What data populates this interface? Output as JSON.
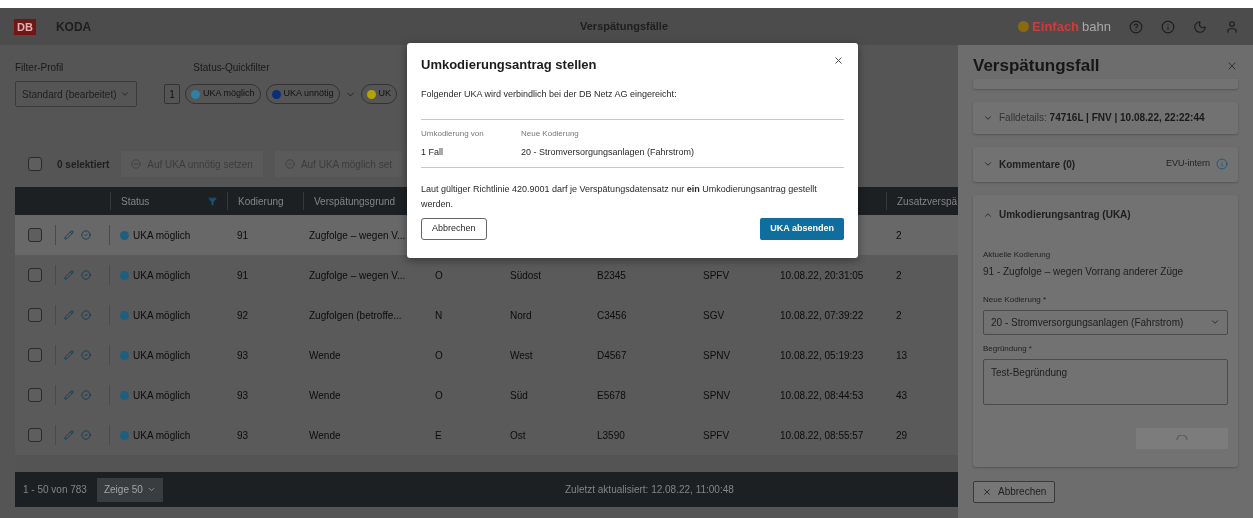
{
  "header": {
    "logo": "DB",
    "app_name": "KODA",
    "title": "Verspätungsfälle",
    "brand_bold": "Einfach",
    "brand_light": "bahn"
  },
  "filter": {
    "profile_label": "Filter-Profil",
    "profile_value": "Standard (bearbeitet)",
    "count": "1",
    "quickfilter_label": "Status-Quickfilter",
    "chips": [
      {
        "label": "UKA möglich",
        "color": "#2f7fa6"
      },
      {
        "label": "UKA unnötig",
        "color": "#0b2e7a"
      },
      {
        "label": "UK",
        "color": "#b3a400"
      }
    ]
  },
  "actions": {
    "select_all_checked": false,
    "selected_count": "0 selektiert",
    "buttons": [
      {
        "label": "Auf UKA unnötig setzen",
        "kind": "minus"
      },
      {
        "label": "Auf UKA möglich set",
        "kind": "check"
      }
    ]
  },
  "table": {
    "columns": [
      "Status",
      "Kodierung",
      "Verspätungsgrund",
      "Zusatzverspä"
    ],
    "rows": [
      {
        "checked": false,
        "selected": true,
        "status": "UKA möglich",
        "kodierung": "91",
        "grund": "Zugfolge – wegen V...",
        "zusatz": "2"
      },
      {
        "checked": false,
        "selected": false,
        "status": "UKA möglich",
        "kodierung": "91",
        "grund": "Zugfolge – wegen V...",
        "column_5": "O",
        "column_6": "Südost",
        "column_7": "B2345",
        "column_8": "SPFV",
        "column_9": "10.08.22, 20:31:05",
        "zusatz": "2"
      },
      {
        "checked": false,
        "selected": false,
        "status": "UKA möglich",
        "kodierung": "92",
        "grund": "Zugfolgen (betroffe...",
        "column_5": "N",
        "column_6": "Nord",
        "column_7": "C3456",
        "column_8": "SGV",
        "column_9": "10.08.22, 07:39:22",
        "zusatz": "2"
      },
      {
        "checked": false,
        "selected": false,
        "status": "UKA möglich",
        "kodierung": "93",
        "grund": "Wende",
        "column_5": "O",
        "column_6": "West",
        "column_7": "D4567",
        "column_8": "SPNV",
        "column_9": "10.08.22, 05:19:23",
        "zusatz": "13"
      },
      {
        "checked": false,
        "selected": false,
        "status": "UKA möglich",
        "kodierung": "93",
        "grund": "Wende",
        "column_5": "O",
        "column_6": "Süd",
        "column_7": "E5678",
        "column_8": "SPNV",
        "column_9": "10.08.22, 08:44:53",
        "zusatz": "43"
      },
      {
        "checked": false,
        "selected": false,
        "status": "UKA möglich",
        "kodierung": "93",
        "grund": "Wende",
        "column_5": "E",
        "column_6": "Ost",
        "column_7": "L3590",
        "column_8": "SPFV",
        "column_9": "10.08.22, 08:55:57",
        "zusatz": "29"
      }
    ]
  },
  "footer": {
    "range": "1 - 50 von 783",
    "page_size": "Zeige 50",
    "updated": "Zuletzt aktualisiert: 12.08.22, 11:00:48"
  },
  "side_panel": {
    "title": "Verspätungsfall",
    "falldetails": {
      "label": "Falldetails:",
      "value": "74716L | FNV | 10.08.22, 22:22:44",
      "expanded": false
    },
    "kommentare": {
      "label": "Kommentare (0)",
      "tag": "EVU-intern",
      "expanded": false
    },
    "uka": {
      "label": "Umkodierungsantrag (UKA)",
      "expanded": true,
      "current_label": "Aktuelle Kodierung",
      "current_value": "91 - Zugfolge – wegen Vorrang anderer Züge",
      "new_label": "Neue Kodierung *",
      "new_value": "20 - Stromversorgungsanlagen (Fahrstrom)",
      "reason_label": "Begründung *",
      "reason_value": "Test-Begründung"
    },
    "cancel": "Abbrechen"
  },
  "dialog": {
    "title": "Umkodierungsantrag stellen",
    "intro": "Folgender UKA wird verbindlich bei der DB Netz AG eingereicht:",
    "from_label": "Umkodierung von",
    "from_value": "1 Fall",
    "to_label": "Neue Kodierung",
    "to_value": "20 - Stromversorgungsanlagen (Fahrstrom)",
    "note": "Laut gültiger Richtlinie 420.9001 darf je Verspätungsdatensatz nur **ein** Umkodierungsantrag gestellt werden.",
    "cancel": "Abbrechen",
    "submit": "UKA absenden"
  }
}
